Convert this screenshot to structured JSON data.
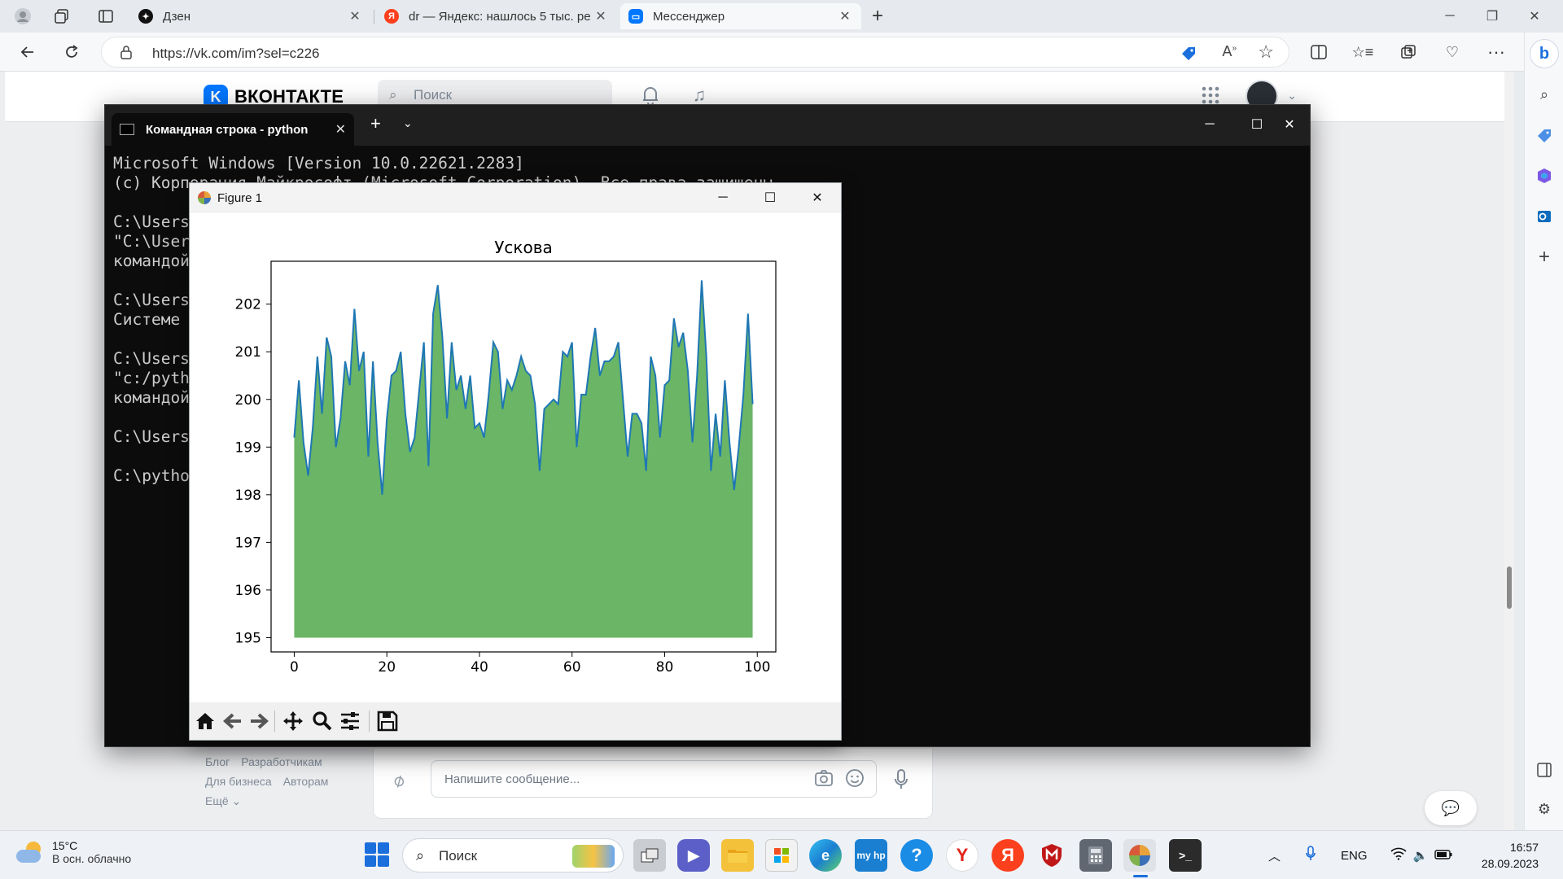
{
  "browser": {
    "tabs": [
      {
        "title": "Дзен",
        "icon": "zen-icon",
        "color": "#111111",
        "active": false
      },
      {
        "title": "dr — Яндекс: нашлось 5 тыс. ре",
        "icon": "yandex-icon",
        "color": "#fc3f1d",
        "active": false
      },
      {
        "title": "Мессенджер",
        "icon": "messenger-icon",
        "color": "#0077ff",
        "active": true
      }
    ],
    "new_tab_symbol": "+",
    "url": "https://vk.com/im?sel=c226"
  },
  "vk": {
    "logo_text": "ВКОНТАКТЕ",
    "search_placeholder": "Поиск",
    "footer_links": {
      "row1": [
        "Блог",
        "Разработчикам"
      ],
      "row2": [
        "Для бизнеса",
        "Авторам"
      ],
      "row3": [
        "Ещё ⌄"
      ]
    },
    "message_placeholder": "Напишите сообщение..."
  },
  "terminal": {
    "tab_title": "Командная строка - python",
    "lines": [
      "Microsoft Windows [Version 10.0.22621.2283]",
      "(c) Корпорация Майкрософт (Microsoft Corporation). Все права защищены.",
      "",
      "C:\\Users",
      "\"C:\\User",
      "командой",
      "",
      "C:\\Users",
      "Системе ",
      "",
      "C:\\Users",
      "\"c:/pyth",
      "командой",
      "",
      "C:\\Users",
      "",
      "C:\\pytho"
    ]
  },
  "figure": {
    "window_title": "Figure 1"
  },
  "chart_data": {
    "type": "area",
    "title": "Ускова",
    "xlabel": "",
    "ylabel": "",
    "xlim": [
      -5,
      104
    ],
    "ylim": [
      194.7,
      202.9
    ],
    "xticks": [
      0,
      20,
      40,
      60,
      80,
      100
    ],
    "yticks": [
      195,
      196,
      197,
      198,
      199,
      200,
      201,
      202
    ],
    "fill_baseline": 195,
    "fill_color": "#6ab566",
    "line_color": "#1f77b4",
    "grid": false,
    "x_start": 0,
    "x_step": 1,
    "values": [
      199.2,
      200.4,
      199.1,
      198.4,
      199.4,
      200.9,
      199.7,
      201.3,
      200.9,
      199.0,
      199.6,
      200.8,
      200.3,
      201.9,
      200.6,
      201.0,
      198.8,
      200.8,
      199.1,
      198.0,
      199.6,
      200.5,
      200.6,
      201.0,
      199.7,
      198.9,
      199.2,
      200.2,
      201.2,
      198.6,
      201.8,
      202.4,
      201.3,
      199.6,
      201.2,
      200.2,
      200.5,
      199.8,
      200.5,
      199.4,
      199.5,
      199.2,
      200.1,
      201.2,
      201.0,
      199.8,
      200.4,
      200.2,
      200.5,
      200.9,
      200.6,
      200.5,
      199.9,
      198.5,
      199.8,
      199.9,
      200.0,
      199.9,
      201.0,
      200.9,
      201.2,
      199.0,
      200.1,
      200.1,
      200.9,
      201.5,
      200.5,
      200.8,
      200.8,
      200.9,
      201.2,
      200.0,
      198.8,
      199.7,
      199.7,
      199.5,
      198.5,
      200.9,
      200.5,
      199.2,
      200.3,
      200.4,
      201.7,
      201.1,
      201.4,
      200.6,
      199.1,
      200.5,
      202.5,
      200.9,
      198.5,
      199.7,
      198.8,
      200.4,
      199.1,
      198.1,
      199.0,
      200.1,
      201.8,
      199.9
    ]
  },
  "taskbar": {
    "weather_temp": "15°C",
    "weather_desc": "В осн. облачно",
    "search_placeholder": "Поиск",
    "language": "ENG",
    "time": "16:57",
    "date": "28.09.2023"
  }
}
